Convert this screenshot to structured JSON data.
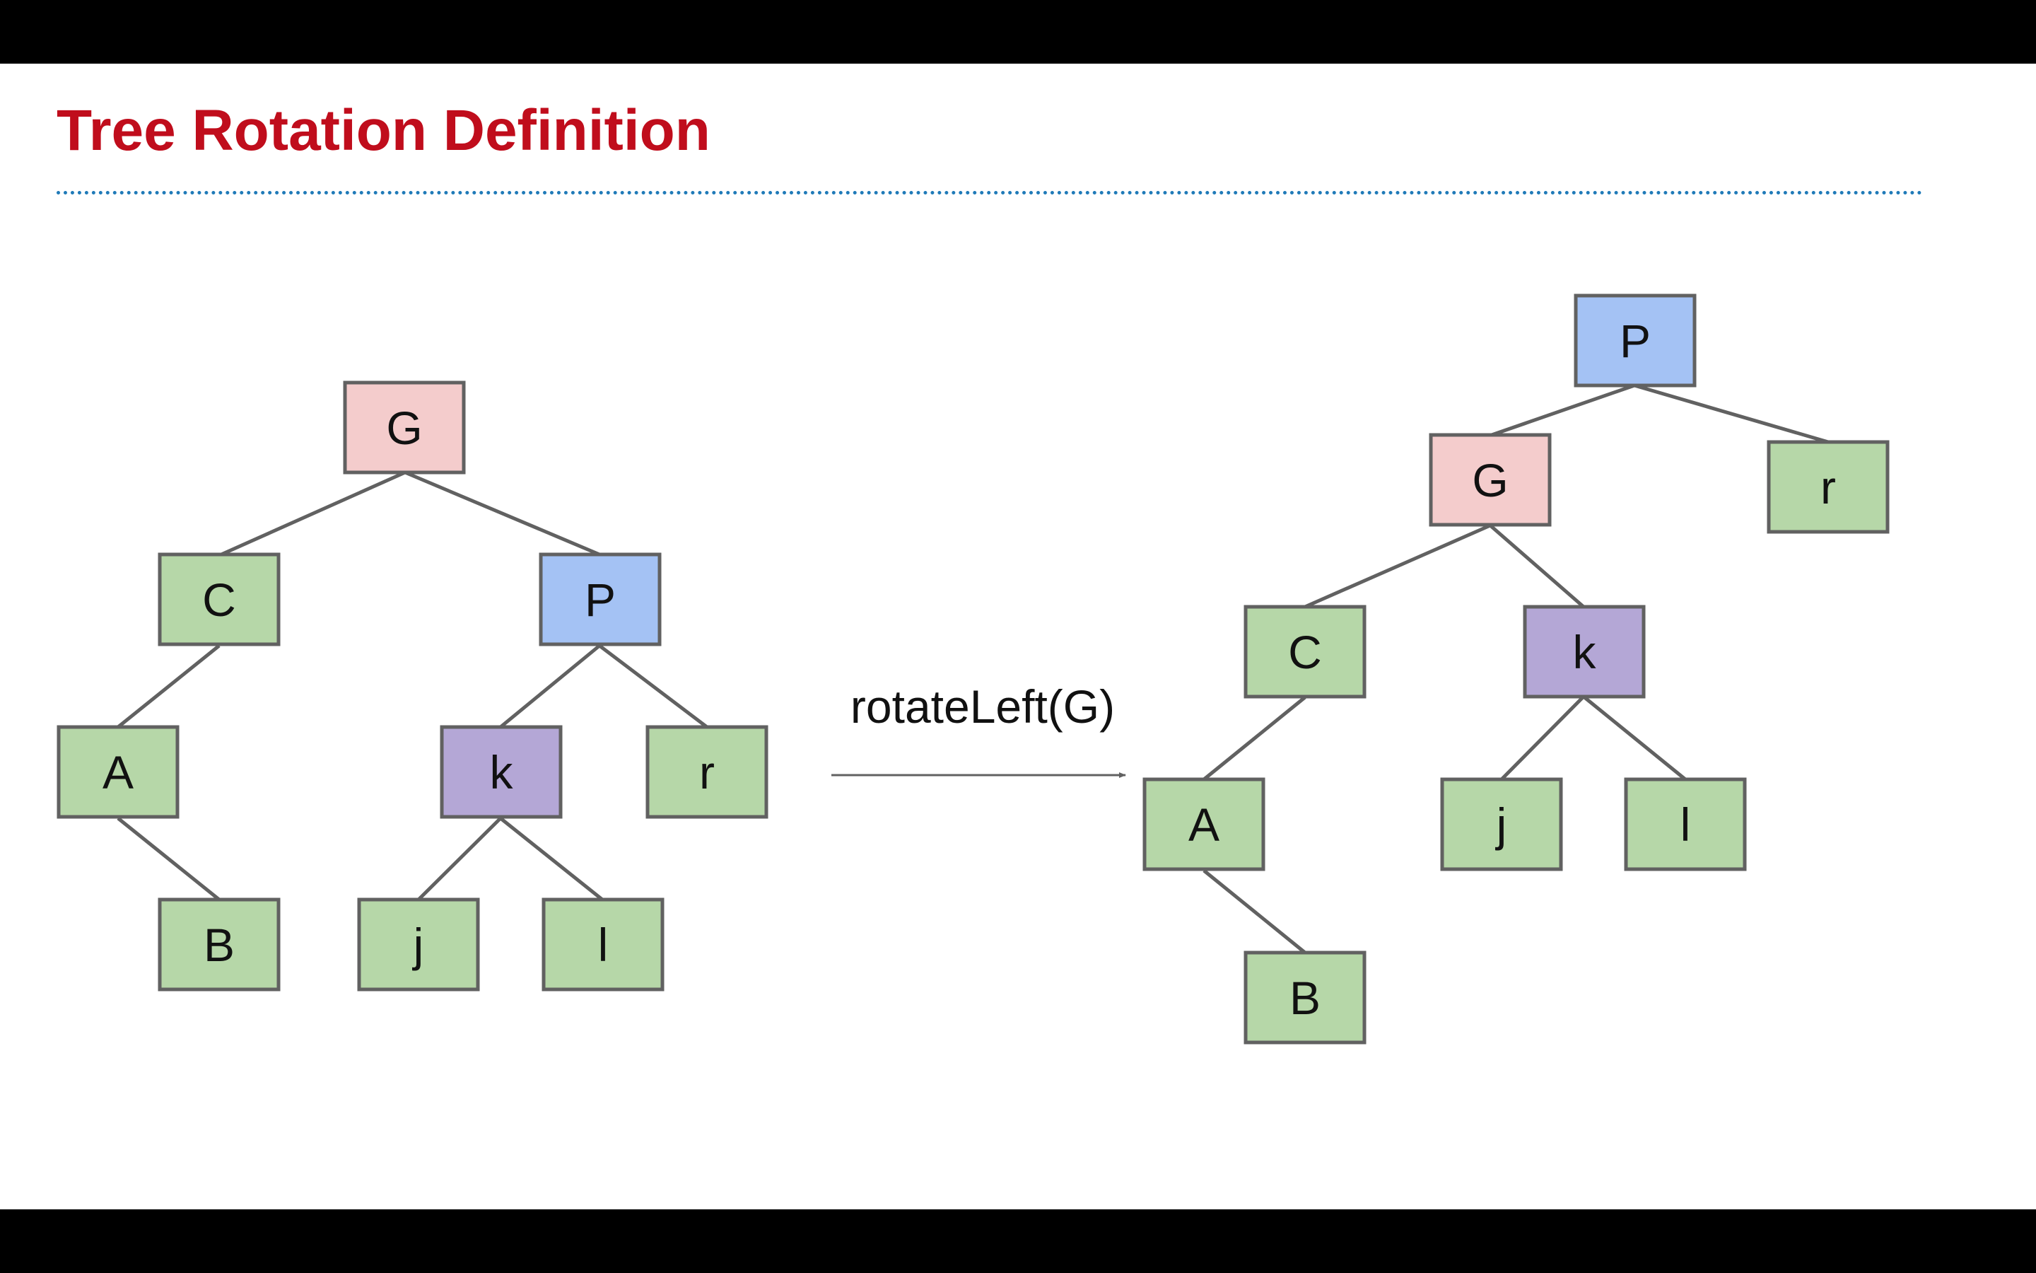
{
  "slide": {
    "title": "Tree Rotation Definition"
  },
  "colors": {
    "title": "#c00d1c",
    "rule": "#1f7ab8",
    "G": "#f4cccc",
    "P": "#a4c2f4",
    "k": "#b4a7d6",
    "leaf": "#b6d7a8",
    "stroke": "#616161"
  },
  "operation": {
    "label": "rotateLeft(G)"
  },
  "trees": {
    "before": {
      "root": {
        "label": "G",
        "color": "G",
        "children": [
          {
            "label": "C",
            "color": "leaf",
            "children": [
              {
                "label": "A",
                "color": "leaf",
                "children": [
                  {
                    "label": "B",
                    "color": "leaf",
                    "children": []
                  }
                ]
              }
            ]
          },
          {
            "label": "P",
            "color": "P",
            "children": [
              {
                "label": "k",
                "color": "k",
                "children": [
                  {
                    "label": "j",
                    "color": "leaf",
                    "children": []
                  },
                  {
                    "label": "l",
                    "color": "leaf",
                    "children": []
                  }
                ]
              },
              {
                "label": "r",
                "color": "leaf",
                "children": []
              }
            ]
          }
        ]
      }
    },
    "after": {
      "root": {
        "label": "P",
        "color": "P",
        "children": [
          {
            "label": "G",
            "color": "G",
            "children": [
              {
                "label": "C",
                "color": "leaf",
                "children": [
                  {
                    "label": "A",
                    "color": "leaf",
                    "children": [
                      {
                        "label": "B",
                        "color": "leaf",
                        "children": []
                      }
                    ]
                  }
                ]
              },
              {
                "label": "k",
                "color": "k",
                "children": [
                  {
                    "label": "j",
                    "color": "leaf",
                    "children": []
                  },
                  {
                    "label": "l",
                    "color": "leaf",
                    "children": []
                  }
                ]
              }
            ]
          },
          {
            "label": "r",
            "color": "leaf",
            "children": []
          }
        ]
      }
    }
  }
}
